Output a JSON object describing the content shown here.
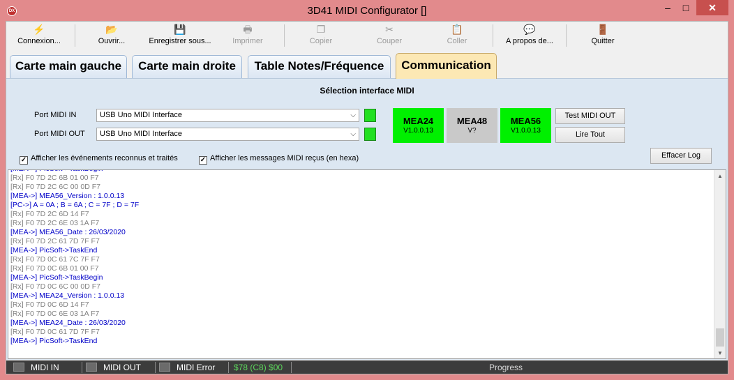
{
  "window": {
    "title": "3D41 MIDI Configurator []",
    "app_icon": "DX",
    "min_glyph": "–",
    "max_glyph": "□",
    "close_glyph": "✕"
  },
  "toolbar": {
    "buttons": [
      {
        "label": "Connexion...",
        "icon": "connect-icon",
        "glyph": "⚡",
        "enabled": true
      },
      {
        "label": "Ouvrir...",
        "icon": "open-folder-icon",
        "glyph": "📂",
        "enabled": true
      },
      {
        "label": "Enregistrer sous...",
        "icon": "save-icon",
        "glyph": "💾",
        "enabled": true
      },
      {
        "label": "Imprimer",
        "icon": "printer-icon",
        "glyph": "🖶",
        "enabled": false
      },
      {
        "label": "Copier",
        "icon": "copy-icon",
        "glyph": "❐",
        "enabled": false
      },
      {
        "label": "Couper",
        "icon": "scissors-icon",
        "glyph": "✂",
        "enabled": false
      },
      {
        "label": "Coller",
        "icon": "paste-icon",
        "glyph": "📋",
        "enabled": false
      },
      {
        "label": "A propos de...",
        "icon": "about-icon",
        "glyph": "💬",
        "enabled": true
      },
      {
        "label": "Quitter",
        "icon": "quit-icon",
        "glyph": "🚪",
        "enabled": true
      }
    ]
  },
  "tabs": [
    {
      "label": "Carte main gauche",
      "active": false
    },
    {
      "label": "Carte main droite",
      "active": false
    },
    {
      "label": "Table Notes/Fréquence",
      "active": false
    },
    {
      "label": "Communication",
      "active": true
    }
  ],
  "midi": {
    "section_title": "Sélection interface MIDI",
    "port_in_label": "Port MIDI IN",
    "port_in_value": "USB Uno MIDI Interface",
    "port_out_label": "Port MIDI OUT",
    "port_out_value": "USB Uno MIDI Interface",
    "led_color": "#22e022",
    "dropdown_glyph": "⌵"
  },
  "modules": [
    {
      "name": "MEA24",
      "version": "V1.0.0.13",
      "status": "connected",
      "color": "#00f000"
    },
    {
      "name": "MEA48",
      "version": "V?",
      "status": "unknown",
      "color": "#c9c9c9"
    },
    {
      "name": "MEA56",
      "version": "V1.0.0.13",
      "status": "connected",
      "color": "#00f000"
    }
  ],
  "buttons": {
    "test_midi_out": "Test MIDI OUT",
    "read_all": "Lire Tout",
    "clear_log": "Effacer Log"
  },
  "checkboxes": {
    "events_label": "Afficher les événements reconnus et traités",
    "events_checked": true,
    "midi_hex_label": "Afficher les messages MIDI reçus (en hexa)",
    "midi_hex_checked": true,
    "check_glyph": "✓"
  },
  "log": [
    {
      "kind": "mea",
      "text": "[MEA->] PicSoft->TaskBegin"
    },
    {
      "kind": "rx",
      "text": "[Rx] F0 7D 2C 6B 01 00 F7"
    },
    {
      "kind": "rx",
      "text": "[Rx] F0 7D 2C 6C 00 0D F7"
    },
    {
      "kind": "mea",
      "text": "[MEA->] MEA56_Version : 1.0.0.13"
    },
    {
      "kind": "mea",
      "text": "[PC->] A = 0A ; B = 6A ; C = 7F ; D = 7F"
    },
    {
      "kind": "rx",
      "text": "[Rx] F0 7D 2C 6D 14 F7"
    },
    {
      "kind": "rx",
      "text": "[Rx] F0 7D 2C 6E 03 1A F7"
    },
    {
      "kind": "mea",
      "text": "[MEA->] MEA56_Date : 26/03/2020"
    },
    {
      "kind": "rx",
      "text": "[Rx] F0 7D 2C 61 7D 7F F7"
    },
    {
      "kind": "mea",
      "text": "[MEA->] PicSoft->TaskEnd"
    },
    {
      "kind": "rx",
      "text": "[Rx] F0 7D 0C 61 7C 7F F7"
    },
    {
      "kind": "rx",
      "text": "[Rx] F0 7D 0C 6B 01 00 F7"
    },
    {
      "kind": "mea",
      "text": "[MEA->] PicSoft->TaskBegin"
    },
    {
      "kind": "rx",
      "text": "[Rx] F0 7D 0C 6C 00 0D F7"
    },
    {
      "kind": "mea",
      "text": "[MEA->] MEA24_Version : 1.0.0.13"
    },
    {
      "kind": "rx",
      "text": "[Rx] F0 7D 0C 6D 14 F7"
    },
    {
      "kind": "rx",
      "text": "[Rx] F0 7D 0C 6E 03 1A F7"
    },
    {
      "kind": "mea",
      "text": "[MEA->] MEA24_Date : 26/03/2020"
    },
    {
      "kind": "rx",
      "text": "[Rx] F0 7D 0C 61 7D 7F F7"
    },
    {
      "kind": "mea",
      "text": "[MEA->] PicSoft->TaskEnd"
    }
  ],
  "scrollbar": {
    "up_glyph": "▲",
    "down_glyph": "▼"
  },
  "status": {
    "midi_in": "MIDI IN",
    "midi_out": "MIDI OUT",
    "midi_error": "MIDI Error",
    "hex": "$78 (C8) $00",
    "progress": "Progress"
  }
}
